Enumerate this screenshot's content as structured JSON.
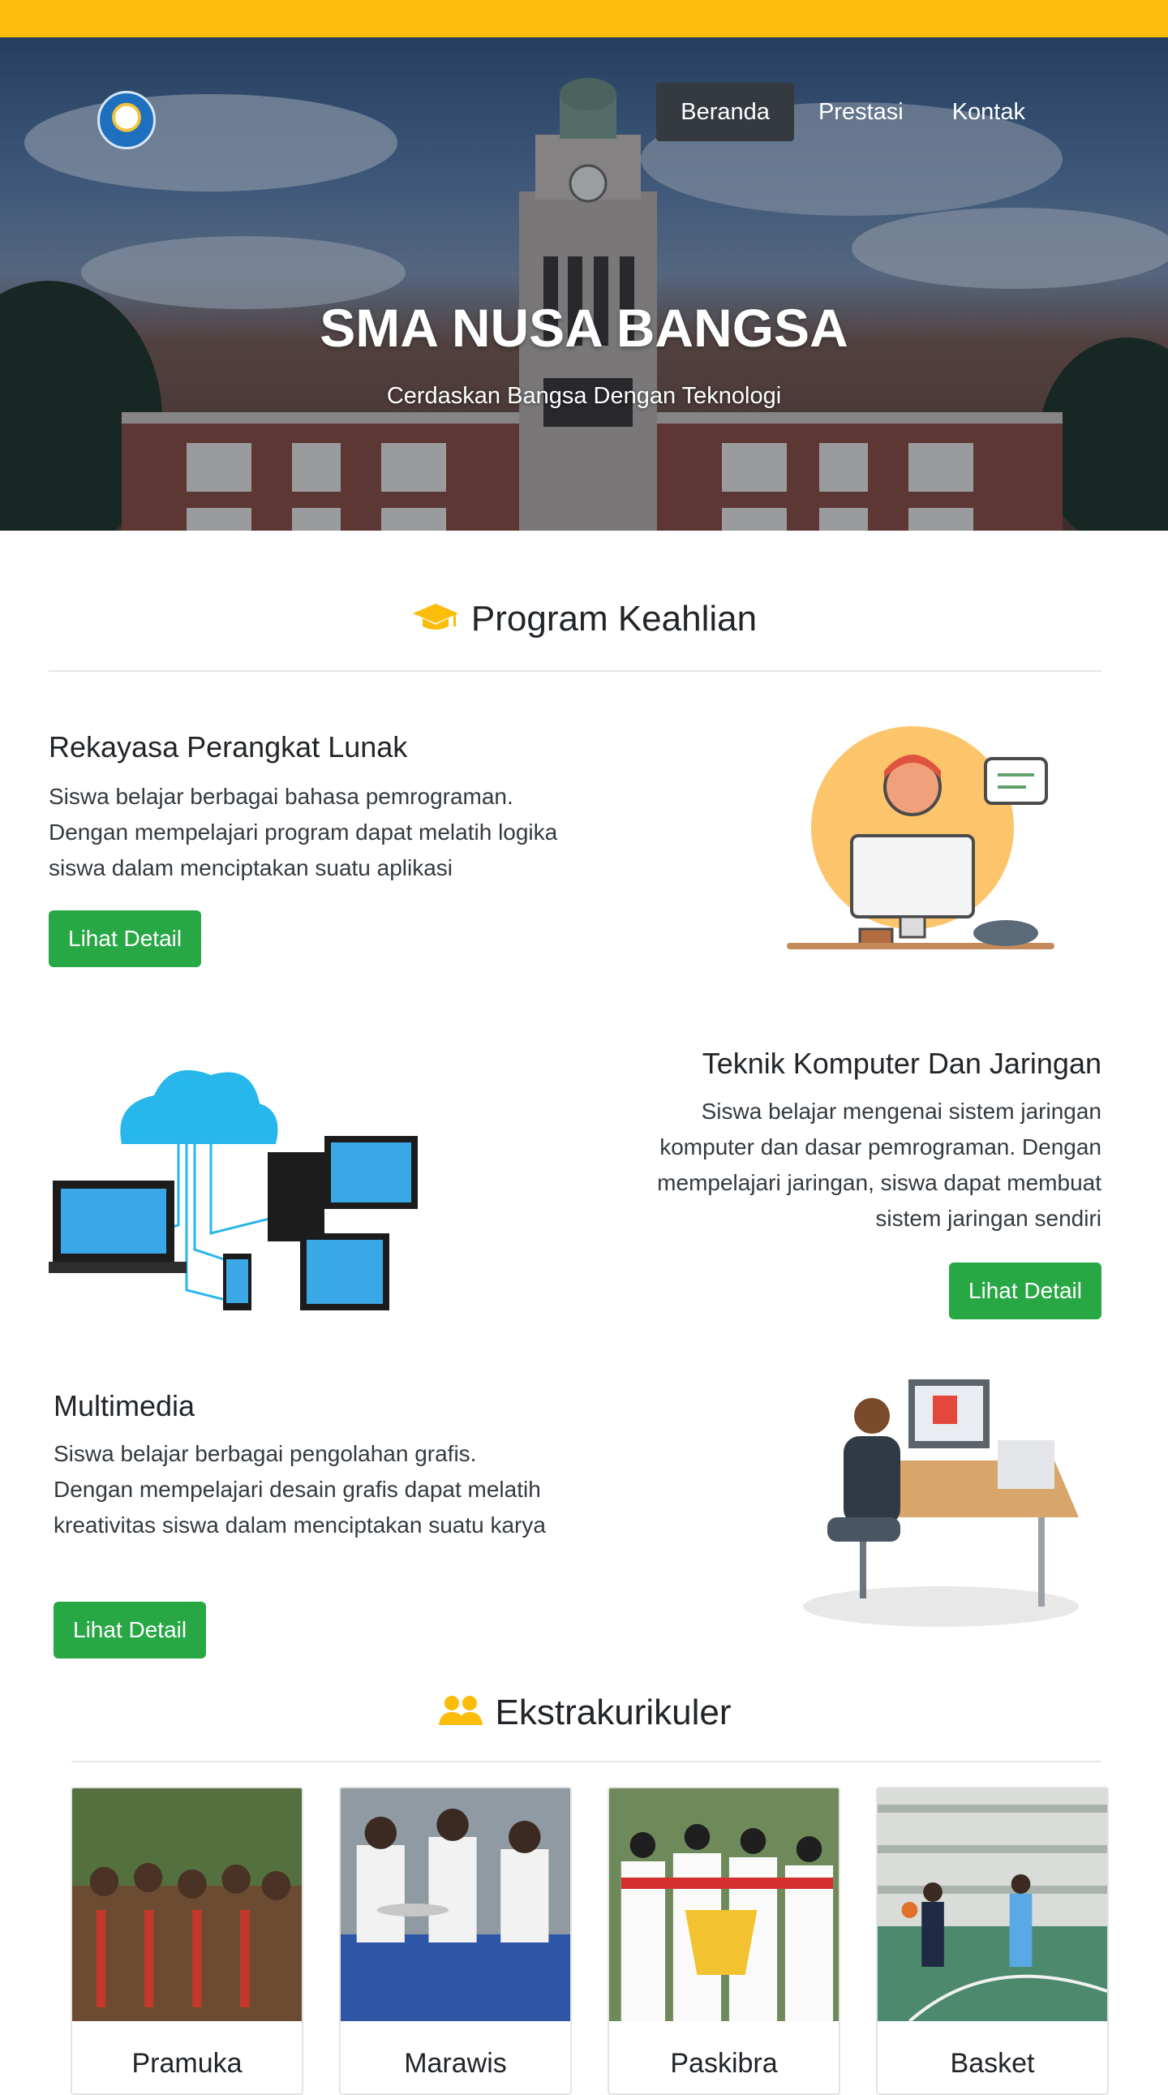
{
  "nav": {
    "items": [
      {
        "label": "Beranda",
        "active": true
      },
      {
        "label": "Prestasi"
      },
      {
        "label": "Kontak"
      }
    ]
  },
  "hero": {
    "title": "SMA NUSA BANGSA",
    "subtitle": "Cerdaskan Bangsa Dengan Teknologi"
  },
  "programs": {
    "title": "Program Keahlian",
    "items": [
      {
        "title": "Rekayasa Perangkat Lunak",
        "description": "Siswa belajar berbagai bahasa pemrograman. Dengan mempelajari program dapat melatih logika siswa dalam menciptakan suatu aplikasi",
        "button": "Lihat Detail"
      },
      {
        "title": "Teknik Komputer Dan Jaringan",
        "description": "Siswa belajar mengenai sistem jaringan komputer dan dasar pemrograman. Dengan mempelajari jaringan, siswa dapat membuat sistem jaringan sendiri",
        "button": "Lihat Detail"
      },
      {
        "title": "Multimedia",
        "description": "Siswa belajar berbagai pengolahan grafis. Dengan mempelajari desain grafis dapat melatih kreativitas siswa dalam menciptakan suatu karya",
        "button": "Lihat Detail"
      }
    ]
  },
  "ekskul": {
    "title": "Ekstrakurikuler",
    "items": [
      {
        "label": "Pramuka"
      },
      {
        "label": "Marawis"
      },
      {
        "label": "Paskibra"
      },
      {
        "label": "Basket"
      }
    ]
  },
  "colors": {
    "accent": "#fbbc0a",
    "button": "#28a745",
    "nav_active": "#343a40"
  }
}
